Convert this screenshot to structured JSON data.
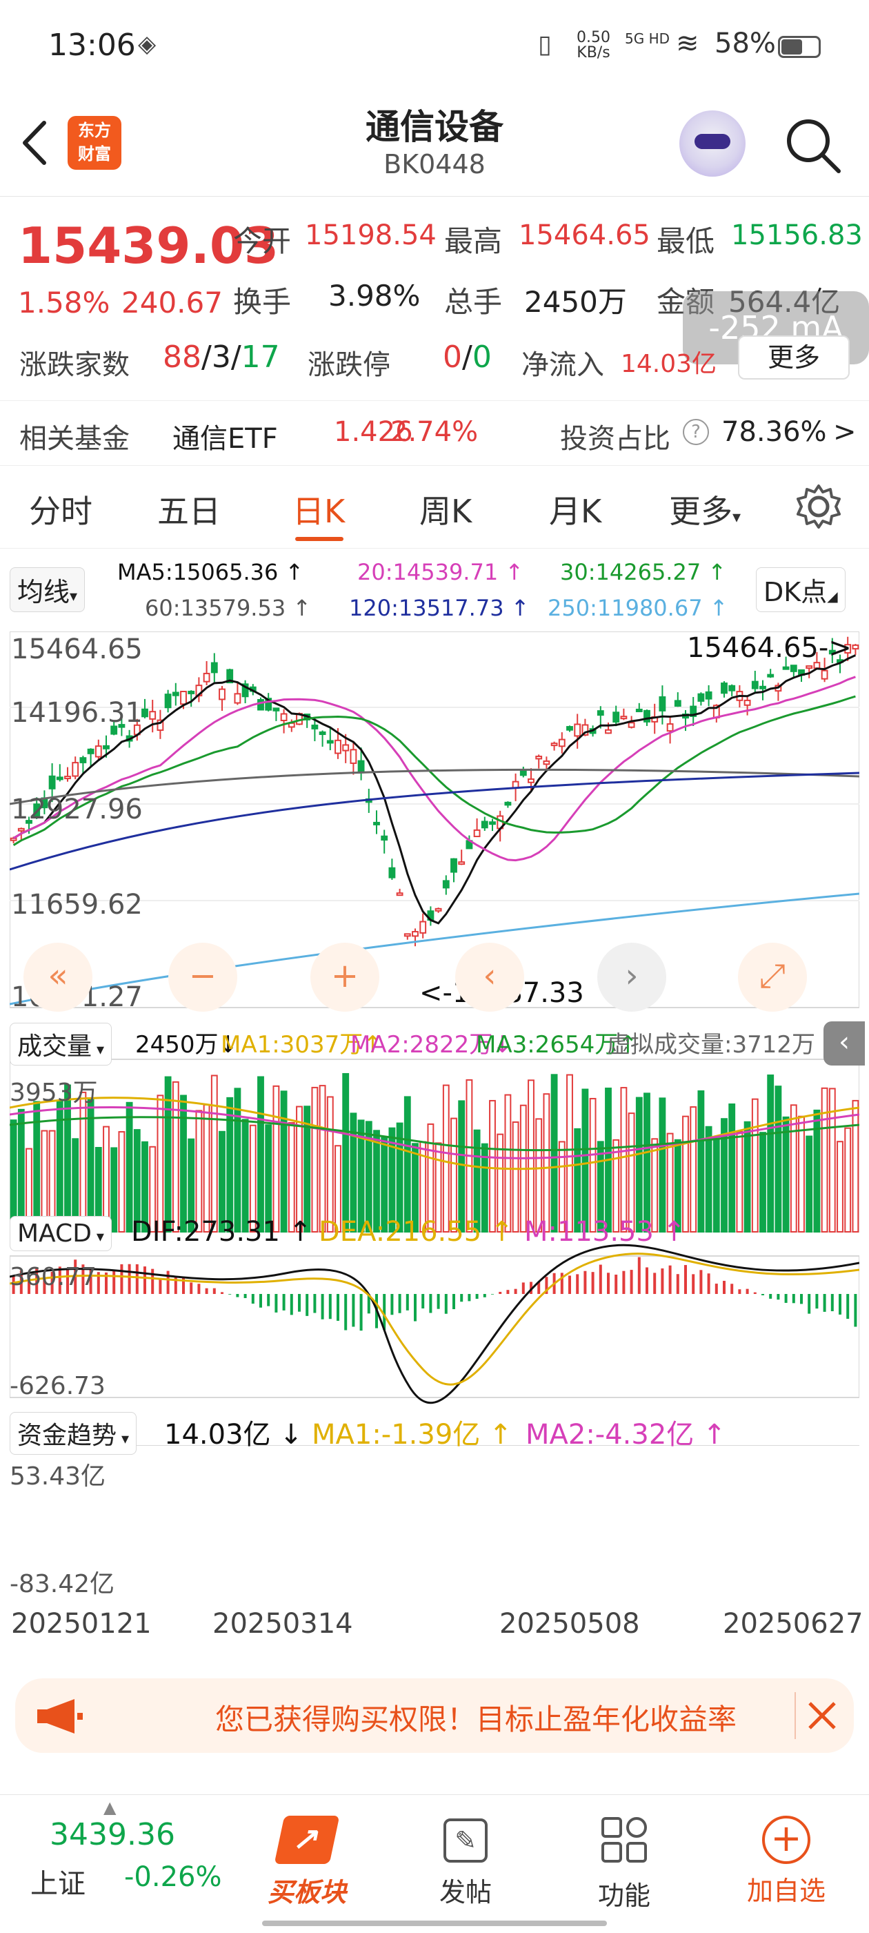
{
  "status_bar": {
    "time": "13:06",
    "net_speed_value": "0.50",
    "net_speed_unit": "KB/s",
    "net_type": "5G HD",
    "battery": "58%"
  },
  "header": {
    "title": "通信设备",
    "code": "BK0448",
    "logo_line1": "东方",
    "logo_line2": "财富"
  },
  "quote": {
    "price": "15439.03",
    "change_pct": "1.58%",
    "change_abs": "240.67",
    "open_label": "今开",
    "open": "15198.54",
    "high_label": "最高",
    "high": "15464.65",
    "low_label": "最低",
    "low": "15156.83",
    "turnover_label": "换手",
    "turnover": "3.98%",
    "volume_label": "总手",
    "volume": "2450万",
    "amount_label": "金额",
    "amount": "564.4亿",
    "updown_label": "涨跌家数",
    "up": "88",
    "flat": "3",
    "down": "17",
    "limit_label": "涨跌停",
    "limit_up": "0",
    "limit_down": "0",
    "inflow_label": "净流入",
    "inflow": "14.03亿",
    "more_button": "更多",
    "overlay": "-252 mA"
  },
  "fund": {
    "label": "相关基金",
    "name": "通信ETF",
    "price": "1.426",
    "change": "2.74%",
    "ratio_label": "投资占比",
    "ratio": "78.36%",
    "arrow": ">"
  },
  "tabs": [
    "分时",
    "五日",
    "日K",
    "周K",
    "月K",
    "更多"
  ],
  "active_tab": "日K",
  "ma_panel": {
    "selector": "均线",
    "ma5": "MA5:15065.36 ↑",
    "ma20": "20:14539.71 ↑",
    "ma30": "30:14265.27 ↑",
    "ma60": "60:13579.53 ↑",
    "ma120": "120:13517.73 ↑",
    "ma250": "250:11980.67 ↑",
    "dk_button": "DK点"
  },
  "price_axis": {
    "top": "15464.65",
    "l2": "14196.31",
    "l3": "12927.96",
    "l4": "11659.62",
    "bottom": "10391.27",
    "high_marker": "15464.65->",
    "low_marker": "<-10687.33"
  },
  "volume_panel": {
    "selector": "成交量",
    "value": "2450万↓",
    "ma1": "MA1:3037万↑",
    "ma2": "MA2:2822万↓",
    "ma3": "MA3:2654万↑",
    "virtual": "虚拟成交量:3712万",
    "axis_top": "3953万"
  },
  "macd_panel": {
    "selector": "MACD",
    "dif": "DIF:273.31 ↑",
    "dea": "DEA:216.55 ↑",
    "m": "M:113.53 ↑",
    "axis_top": "360.77",
    "axis_bottom": "-626.73"
  },
  "fund_panel": {
    "selector": "资金趋势",
    "value": "14.03亿 ↓",
    "ma1": "MA1:-1.39亿 ↑",
    "ma2": "MA2:-4.32亿 ↑",
    "axis_top": "53.43亿",
    "axis_bottom": "-83.42亿"
  },
  "dates": [
    "20250121",
    "20250314",
    "20250508",
    "20250627"
  ],
  "banner": {
    "text": "您已获得购买权限！目标止盈年化收益率"
  },
  "bottom_nav": {
    "index_value": "3439.36",
    "index_name": "上证",
    "index_change": "-0.26%",
    "buy_block": "买板块",
    "post": "发帖",
    "function": "功能",
    "add_watch": "加自选"
  },
  "colors": {
    "up": "#e23c3c",
    "down": "#0ea64b",
    "accent": "#e8511b",
    "ma5": "#111111",
    "ma20": "#d63fb8",
    "ma30": "#1a9a2e",
    "ma60": "#666666",
    "ma120": "#1f2f9e",
    "ma250": "#5ab0e0"
  }
}
